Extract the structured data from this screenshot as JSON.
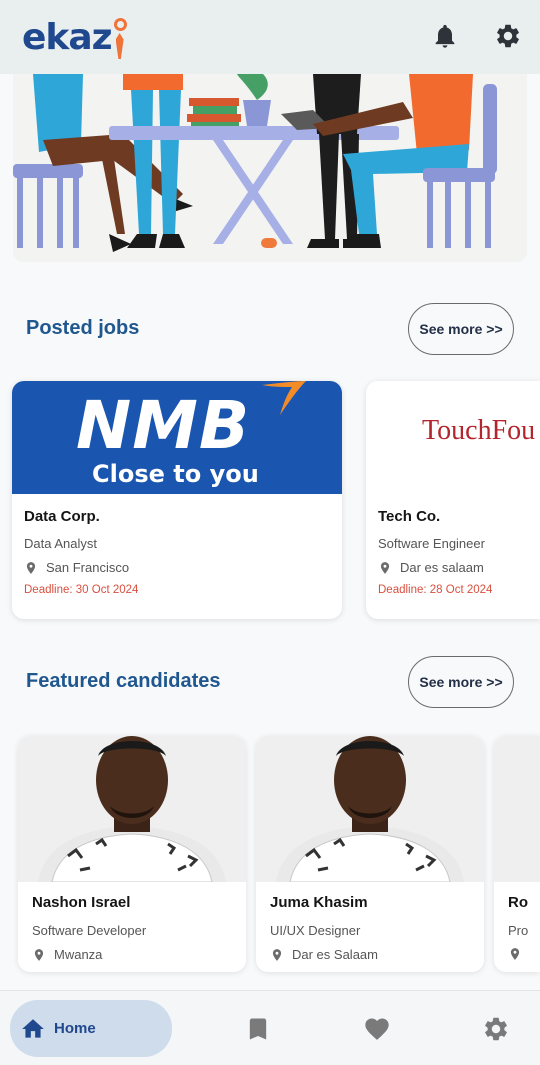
{
  "app": {
    "logo_text": "ekaz"
  },
  "header": {
    "notification_icon": "bell-icon",
    "settings_icon": "gear-icon"
  },
  "posted_jobs": {
    "title": "Posted jobs",
    "see_more": "See more >>",
    "jobs": [
      {
        "company": "Data Corp.",
        "banner_logo": "NMB",
        "banner_tagline": "Close to you",
        "title": "Data Analyst",
        "location": "San Francisco",
        "deadline": "Deadline: 30 Oct 2024"
      },
      {
        "company": "Tech Co.",
        "banner_logo": "TouchFou",
        "title": "Software Engineer",
        "location": "Dar es salaam",
        "deadline": "Deadline: 28 Oct 2024"
      }
    ]
  },
  "featured_candidates": {
    "title": "Featured candidates",
    "see_more": "See more >>",
    "candidates": [
      {
        "name": "Nashon Israel",
        "role": "Software Developer",
        "location": "Mwanza"
      },
      {
        "name": "Juma Khasim",
        "role": "UI/UX Designer",
        "location": "Dar es Salaam"
      },
      {
        "name": "Ro",
        "role": "Pro",
        "location": ""
      }
    ]
  },
  "bottom_nav": {
    "home_label": "Home",
    "items": [
      "home-icon",
      "bookmark-icon",
      "heart-icon",
      "gear-icon"
    ]
  },
  "colors": {
    "brand": "#20488f",
    "accent": "#f0733a",
    "deadline": "#d9503f",
    "nmb_blue": "#1a56b0"
  }
}
